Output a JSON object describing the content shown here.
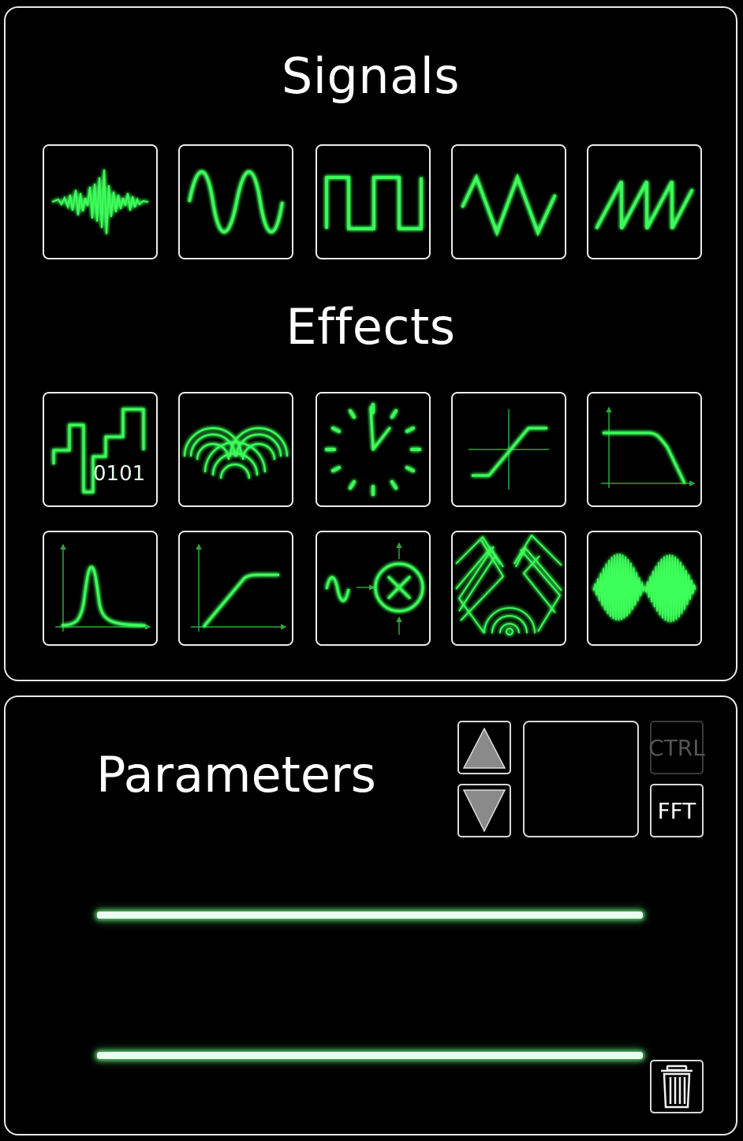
{
  "signals": {
    "title": "Signals",
    "items": [
      {
        "name": "noise",
        "icon": "noise-waveform-icon"
      },
      {
        "name": "sine",
        "icon": "sine-wave-icon"
      },
      {
        "name": "square",
        "icon": "square-wave-icon"
      },
      {
        "name": "triangle",
        "icon": "triangle-wave-icon"
      },
      {
        "name": "sawtooth",
        "icon": "sawtooth-wave-icon"
      }
    ]
  },
  "effects": {
    "title": "Effects",
    "items": [
      {
        "name": "bitcrusher",
        "icon": "bitcrusher-icon",
        "label": "0101"
      },
      {
        "name": "reverb",
        "icon": "ripple-reverb-icon"
      },
      {
        "name": "delay",
        "icon": "clock-icon"
      },
      {
        "name": "distortion",
        "icon": "transfer-curve-icon"
      },
      {
        "name": "lowpass",
        "icon": "lowpass-filter-icon"
      },
      {
        "name": "bandpass",
        "icon": "bandpass-peak-icon"
      },
      {
        "name": "compressor",
        "icon": "compressor-curve-icon"
      },
      {
        "name": "ring-modulator",
        "icon": "ring-modulator-icon"
      },
      {
        "name": "echo-reflections",
        "icon": "reflections-icon"
      },
      {
        "name": "tremolo",
        "icon": "amplitude-modulation-icon"
      }
    ]
  },
  "parameters": {
    "title": "Parameters",
    "ctrl_label": "CTRL",
    "fft_label": "FFT",
    "sliders": [
      {
        "name": "parameter-1"
      },
      {
        "name": "parameter-2"
      }
    ]
  },
  "colors": {
    "accent": "#3dff5a",
    "border": "#e8e8e8",
    "background": "#000000",
    "disabled": "#555555"
  }
}
